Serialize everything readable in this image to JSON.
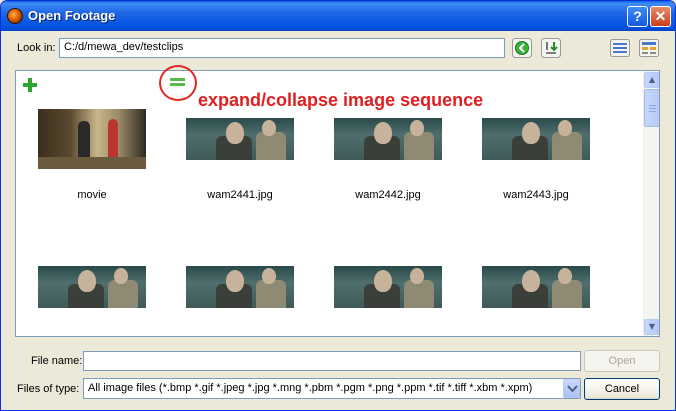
{
  "window": {
    "title": "Open Footage",
    "help_label": "?",
    "close_label": "✕"
  },
  "look_in": {
    "label": "Look in:",
    "path": "C:/d/mewa_dev/testclips"
  },
  "annotation": {
    "text": "expand/collapse image sequence",
    "color": "#e02020"
  },
  "gallery": {
    "items": [
      {
        "label": "movie"
      },
      {
        "label": "wam2441.jpg"
      },
      {
        "label": "wam2442.jpg"
      },
      {
        "label": "wam2443.jpg"
      },
      {
        "label": ""
      },
      {
        "label": ""
      },
      {
        "label": ""
      },
      {
        "label": ""
      }
    ]
  },
  "file_name": {
    "label": "File name:",
    "value": ""
  },
  "file_type": {
    "label": "Files of type:",
    "selected": "All image files (*.bmp *.gif *.jpeg *.jpg *.mng *.pbm *.pgm *.png *.ppm *.tif *.tiff *.xbm *.xpm)"
  },
  "buttons": {
    "open": "Open",
    "cancel": "Cancel"
  },
  "icons": {
    "app": "app-logo-icon",
    "back": "go-back-icon",
    "download": "download-icon",
    "list_view": "list-view-icon",
    "detail_view": "detail-view-icon",
    "add": "plus-icon",
    "collapse": "collapse-sequence-icon"
  }
}
